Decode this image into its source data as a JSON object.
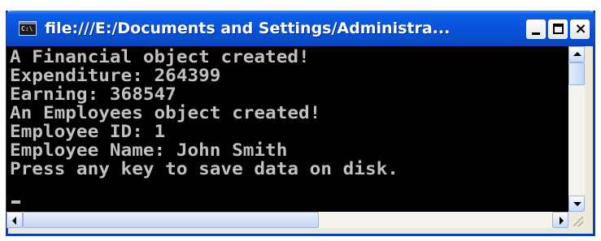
{
  "window": {
    "title": "file:///E:/Documents and Settings/Administra...",
    "app_icon_text": "C:\\",
    "controls": {
      "minimize": "minimize",
      "maximize": "maximize",
      "close": "×"
    }
  },
  "console": {
    "lines": [
      "A Financial object created!",
      "Expenditure: 264399",
      "Earning: 368547",
      "An Employees object created!",
      "Employee ID: 1",
      "Employee Name: John Smith",
      "Press any key to save data on disk."
    ],
    "text_color": "#c0c0c0",
    "background_color": "#000000"
  },
  "scrollbars": {
    "vertical": {
      "position": 0.0
    },
    "horizontal": {
      "position": 0.0
    }
  },
  "colors": {
    "titlebar": "#0a54dc",
    "frame": "#0a3fb8",
    "scroll_track": "#f4f3ee"
  }
}
